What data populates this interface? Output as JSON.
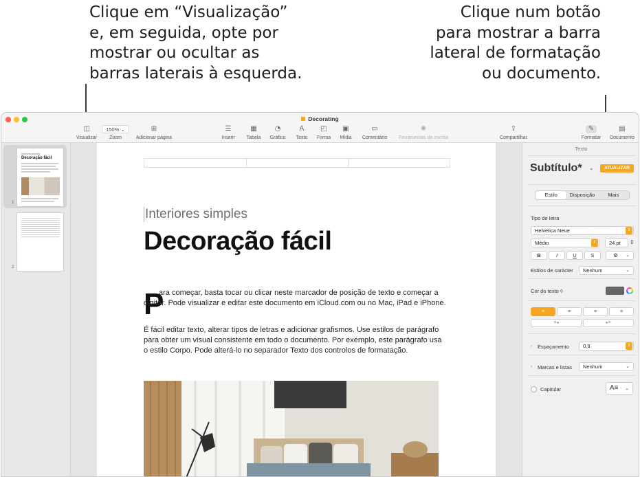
{
  "callouts": {
    "left": [
      "Clique em “Visualização”",
      "e, em seguida, opte por",
      "mostrar ou ocultar as",
      "barras laterais à esquerda."
    ],
    "right": [
      "Clique num botão",
      "para mostrar a barra",
      "lateral de formatação",
      "ou documento."
    ]
  },
  "window": {
    "title": "Decorating"
  },
  "toolbar": {
    "view": "Visualizar",
    "zoom_value": "150%",
    "zoom": "Zoom",
    "add_page": "Adicionar página",
    "insert": "Inserir",
    "table": "Tabela",
    "chart": "Gráfico",
    "text": "Texto",
    "shape": "Forma",
    "media": "Mídia",
    "comment": "Comentário",
    "writing_tools": "Ferramentas de escrita",
    "share": "Compartilhar",
    "format": "Formatar",
    "document": "Documento"
  },
  "thumbnails": {
    "page1_num": "1",
    "page2_num": "2",
    "page1_title": "Decoração fácil",
    "page1_sub": "Interiores simples"
  },
  "document": {
    "subtitle": "Interiores simples",
    "title": "Decoração fácil",
    "dropcap": "P",
    "p1": "ara começar, basta tocar ou clicar neste marcador de posição de texto e começar a digitar. Pode visualizar e editar este documento em iCloud.com ou no Mac, iPad e iPhone.",
    "p2": "É fácil editar texto, alterar tipos de letras e adicionar grafismos. Use estilos de parágrafo para obter um visual consistente em todo o documento. Por exemplo, este parágrafo usa o estilo Corpo. Pode alterá-lo no separador Texto dos controlos de formatação."
  },
  "sidebar": {
    "top_label": "Texto",
    "style_name": "Subtítulo*",
    "update_button": "ATUALIZAR",
    "tabs": [
      "Estilo",
      "Disposição",
      "Mais"
    ],
    "font_section": "Tipo de letra",
    "font_family": "Helvetica Neue",
    "font_weight": "Médio",
    "font_size": "24 pt",
    "bold": "B",
    "italic": "I",
    "underline": "U",
    "strike": "S",
    "char_styles_label": "Estilos de carácter",
    "char_styles_value": "Nenhum",
    "text_color_label": "Cor do texto ◊",
    "spacing_label": "Espaçamento",
    "spacing_value": "0,9",
    "bullets_label": "Marcas e listas",
    "bullets_value": "Nenhum",
    "dropcap_label": "Capitular"
  },
  "colors": {
    "accent": "#f5a623",
    "text_color_swatch": "#666666"
  }
}
